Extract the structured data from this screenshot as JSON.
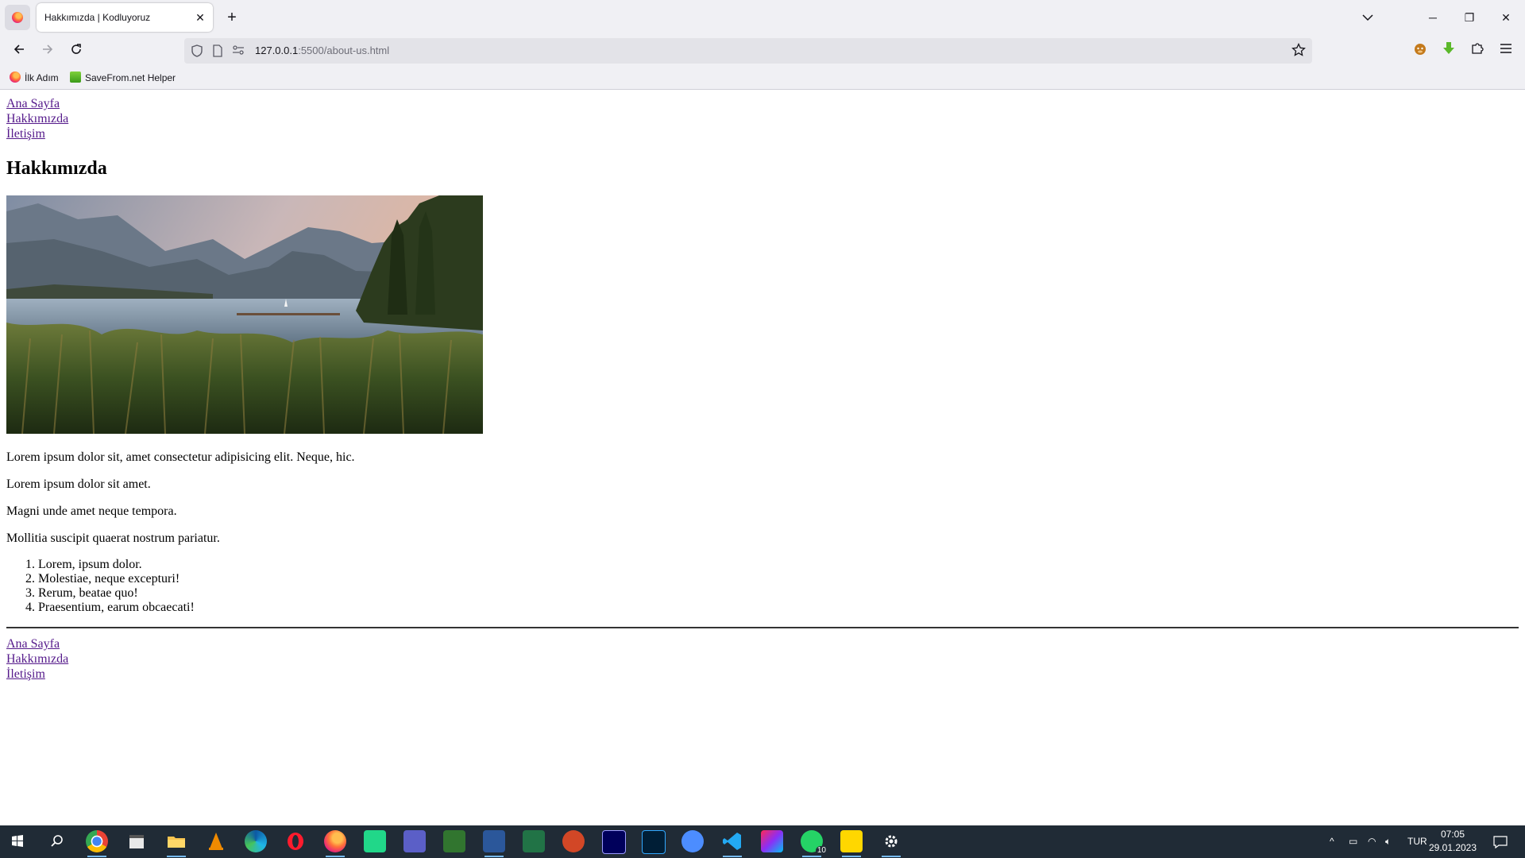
{
  "browser": {
    "tab_title": "Hakkımızda | Kodluyoruz",
    "url_host": "127.0.0.1",
    "url_rest": ":5500/about-us.html",
    "bookmarks": [
      {
        "label": "İlk Adım",
        "icon": "firefox-icon"
      },
      {
        "label": "SaveFrom.net Helper",
        "icon": "savefrom-icon"
      }
    ]
  },
  "page": {
    "nav_top": [
      "Ana Sayfa",
      "Hakkımızda",
      "İletişim"
    ],
    "heading": "Hakkımızda",
    "paragraphs": [
      "Lorem ipsum dolor sit, amet consectetur adipisicing elit. Neque, hic.",
      "Lorem ipsum dolor sit amet.",
      "Magni unde amet neque tempora.",
      "Mollitia suscipit quaerat nostrum pariatur."
    ],
    "list_items": [
      "Lorem, ipsum dolor.",
      "Molestiae, neque excepturi!",
      "Rerum, beatae quo!",
      "Praesentium, earum obcaecati!"
    ],
    "nav_bottom": [
      "Ana Sayfa",
      "Hakkımızda",
      "İletişim"
    ],
    "link_color": "#551a8b"
  },
  "taskbar": {
    "language": "TUR",
    "time": "07:05",
    "date": "29.01.2023",
    "whatsapp_badge": "10"
  }
}
